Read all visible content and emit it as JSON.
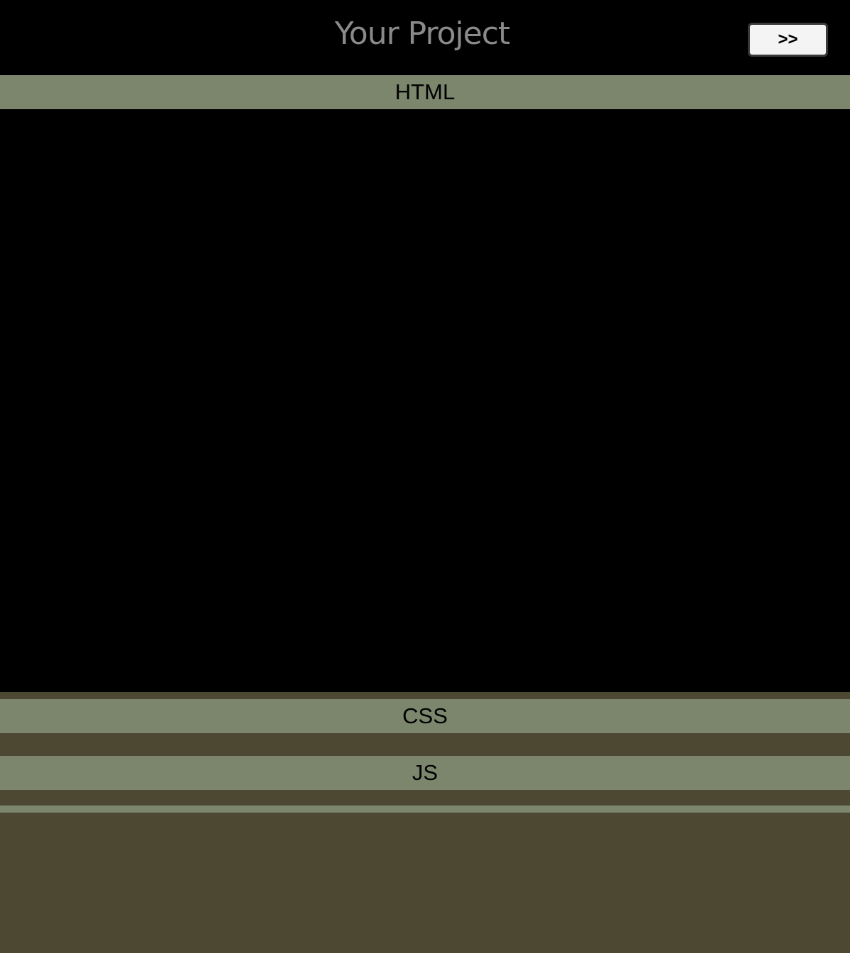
{
  "header": {
    "title": "Your Project",
    "toggle_label": ">>"
  },
  "panels": [
    {
      "label": "HTML",
      "expanded": true
    },
    {
      "label": "CSS",
      "expanded": false
    },
    {
      "label": "JS",
      "expanded": false
    }
  ],
  "colors": {
    "header_bg": "#000000",
    "panel_bar": "#7c866d",
    "page_bg": "#4d4832",
    "editor_bg": "#000000",
    "title_text": "#8a8a8a"
  }
}
